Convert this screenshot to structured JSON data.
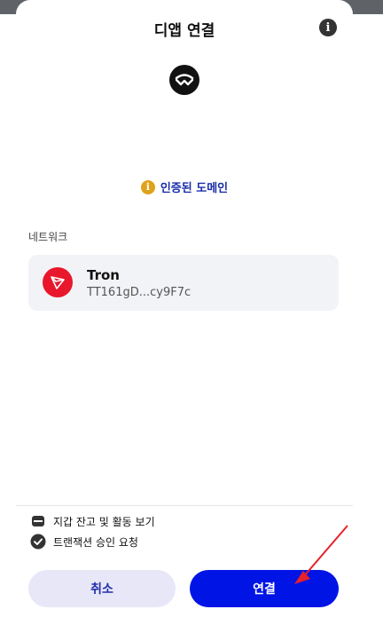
{
  "header": {
    "title": "디앱 연결",
    "info_icon": "info-icon"
  },
  "dapp": {
    "logo_icon": "walletconnect-logo-icon",
    "verified_text": "인증된 도메인"
  },
  "network": {
    "label": "네트워크",
    "name": "Tron",
    "address": "TT161gD...cy9F7c",
    "logo_icon": "tron-logo-icon"
  },
  "permissions": [
    {
      "icon": "wallet-icon",
      "text": "지갑 잔고 및 활동 보기"
    },
    {
      "icon": "check-circle-icon",
      "text": "트랜잭션 승인 요청"
    }
  ],
  "buttons": {
    "cancel_label": "취소",
    "connect_label": "연결"
  },
  "colors": {
    "primary": "#0014e6",
    "cancel_bg": "#e7e7f8",
    "verified_text": "#1a2ea8",
    "verified_badge": "#e0a21a",
    "tron_red": "#e8172b",
    "annotation_arrow": "#e8202a"
  }
}
